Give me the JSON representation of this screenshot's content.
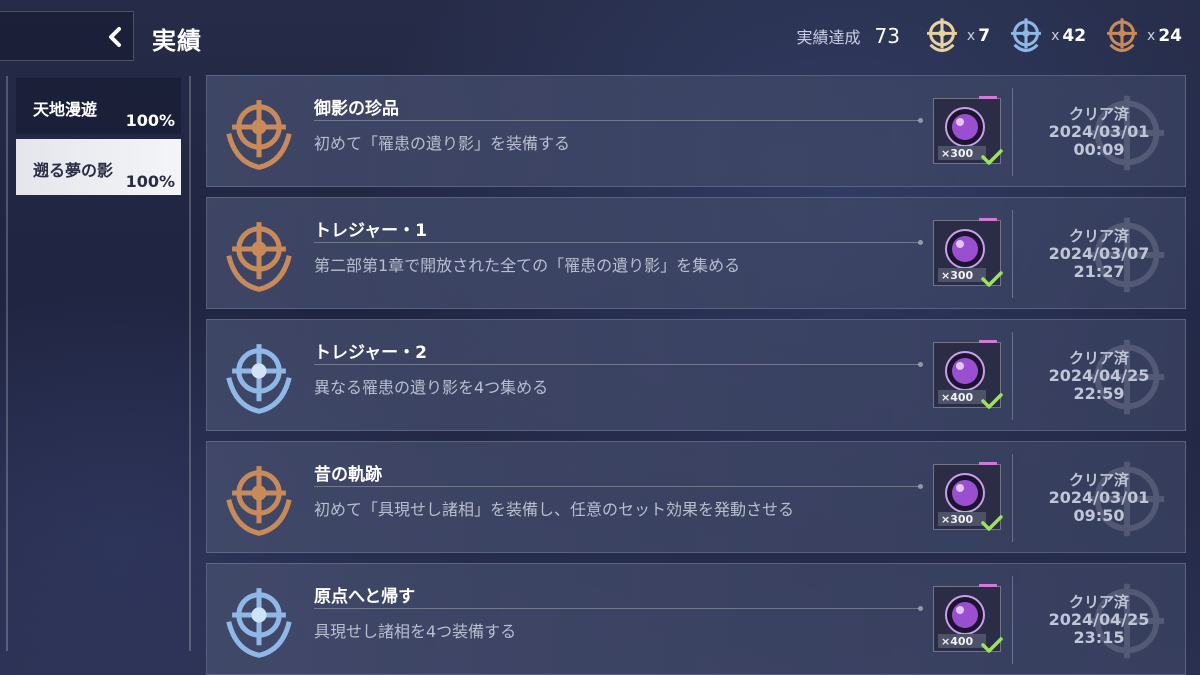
{
  "header": {
    "title": "実績",
    "summary_label": "実績達成",
    "summary_count": "73",
    "medals": [
      {
        "tier": "gold",
        "icon": "gold-medal-icon",
        "prefix": "x",
        "count": "7"
      },
      {
        "tier": "silver",
        "icon": "silver-medal-icon",
        "prefix": "x",
        "count": "42"
      },
      {
        "tier": "bronze",
        "icon": "bronze-medal-icon",
        "prefix": "x",
        "count": "24"
      }
    ]
  },
  "sidebar": {
    "categories": [
      {
        "name": "天地漫遊",
        "percent": "100%",
        "selected": false
      },
      {
        "name": "遡る夢の影",
        "percent": "100%",
        "selected": true
      }
    ]
  },
  "colors": {
    "bronze": "#c98a5a",
    "silver": "#8fb8e6",
    "gold": "#e8d2a0",
    "check": "#9be35a",
    "orb": "#9a4fd0"
  },
  "achievements": [
    {
      "title": "御影の珍品",
      "description": "初めて「罹患の遺り影」を装備する",
      "medal": "bronze",
      "reward_qty": "×300",
      "status": "クリア済",
      "date": "2024/03/01",
      "time": "00:09"
    },
    {
      "title": "トレジャー・1",
      "description": "第二部第1章で開放された全ての「罹患の遺り影」を集める",
      "medal": "bronze",
      "reward_qty": "×300",
      "status": "クリア済",
      "date": "2024/03/07",
      "time": "21:27"
    },
    {
      "title": "トレジャー・2",
      "description": "異なる罹患の遺り影を4つ集める",
      "medal": "silver",
      "reward_qty": "×400",
      "status": "クリア済",
      "date": "2024/04/25",
      "time": "22:59"
    },
    {
      "title": "昔の軌跡",
      "description": "初めて「具現せし諸相」を装備し、任意のセット効果を発動させる",
      "medal": "bronze",
      "reward_qty": "×300",
      "status": "クリア済",
      "date": "2024/03/01",
      "time": "09:50"
    },
    {
      "title": "原点へと帰す",
      "description": "具現せし諸相を4つ装備する",
      "medal": "silver",
      "reward_qty": "×400",
      "status": "クリア済",
      "date": "2024/04/25",
      "time": "23:15"
    }
  ]
}
